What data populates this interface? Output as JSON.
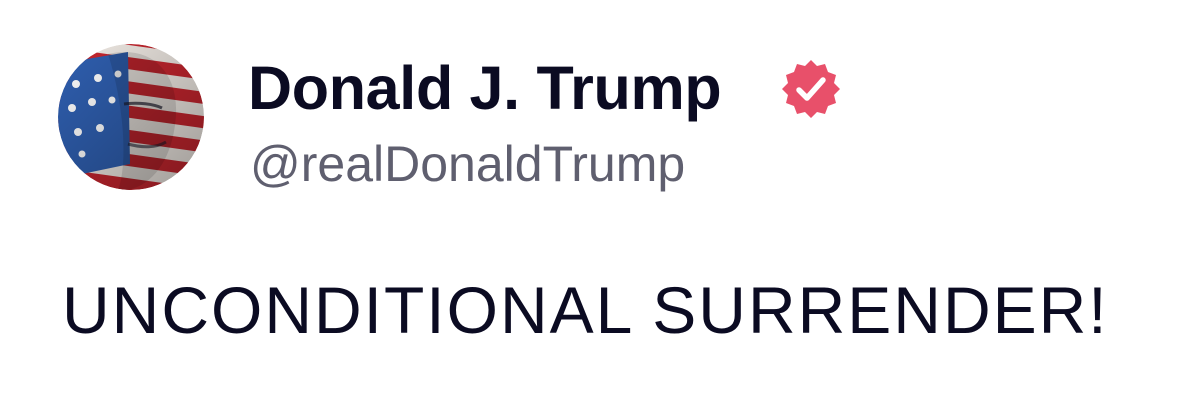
{
  "post": {
    "author": {
      "display_name": "Donald J. Trump",
      "handle": "@realDonaldTrump",
      "avatar_icon": "profile-avatar-flag-portrait",
      "verified_icon": "verified-badge-icon",
      "verified_color": "#e8506a"
    },
    "body_text": "UNCONDITIONAL SURRENDER!",
    "colors": {
      "name_text": "#0b0b22",
      "handle_text": "#5f5f6f",
      "body_text": "#0b0b22",
      "background": "#ffffff"
    }
  }
}
